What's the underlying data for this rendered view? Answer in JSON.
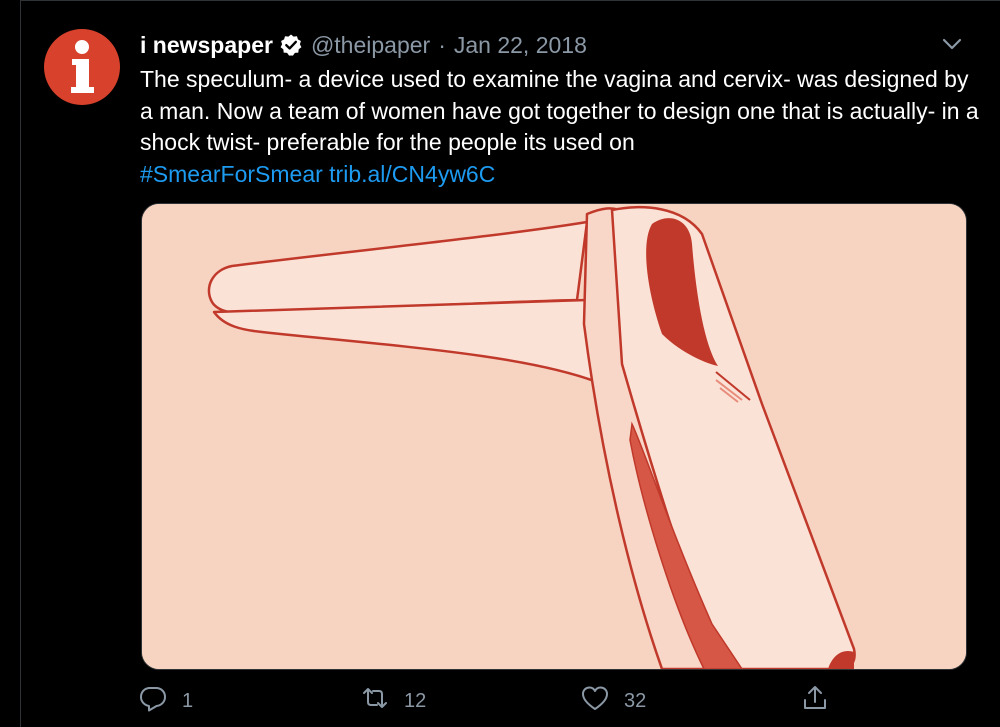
{
  "tweet": {
    "display_name": "i newspaper",
    "handle": "@theipaper",
    "separator": "·",
    "date": "Jan 22, 2018",
    "avatar_letter": "i",
    "text_body": "The speculum- a device used to examine the vagina and cervix- was designed by a man. Now a team of women have got together to design one that is actually- in a shock twist- preferable for the people its used on",
    "hashtag": "#SmearForSmear",
    "link": "trib.al/CN4yw6C"
  },
  "actions": {
    "reply_count": "1",
    "retweet_count": "12",
    "like_count": "32"
  },
  "icons": {
    "verified": "verified-badge-icon",
    "menu": "chevron-down-icon",
    "reply": "reply-icon",
    "retweet": "retweet-icon",
    "like": "heart-icon",
    "share": "share-icon"
  },
  "colors": {
    "background": "#000000",
    "accent": "#1d9bf0",
    "avatar": "#d8412c",
    "muted": "#8b98a5",
    "media_background": "#f7d3c1"
  }
}
